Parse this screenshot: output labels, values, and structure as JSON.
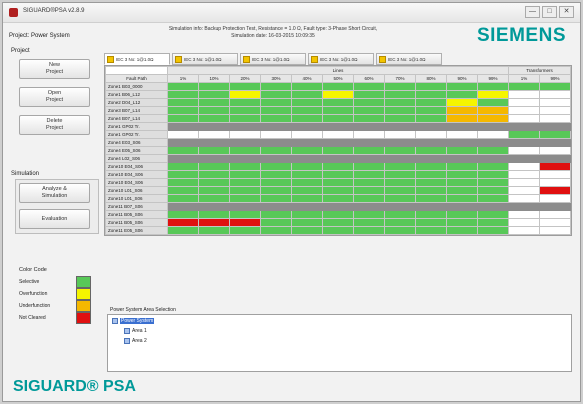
{
  "window": {
    "title": "SIGUARD®PSA v2.8.9",
    "buttons": [
      "—",
      "□",
      "✕"
    ]
  },
  "project_label": "Project: Power System",
  "simulation_info": {
    "line1": "Simulation info: Backup Protection Test, Resistance = 1.0 Ω, Fault type: 3-Phase Short Circuit,",
    "line2": "Simulation date: 16-03-2015 10:09:35"
  },
  "brand_logo": "SIEMENS",
  "sidebar": {
    "project_title": "Project",
    "project_buttons": [
      "New\nProject",
      "Open\nProject",
      "Delete\nProject"
    ],
    "simulation_title": "Simulation",
    "simulation_buttons": [
      "Analyze &\nSimulation",
      "Evaluation"
    ]
  },
  "legend": {
    "title": "Color Code",
    "items": [
      {
        "label": "Selective",
        "color": "#58c858"
      },
      {
        "label": "Overfunction",
        "color": "#f5f500"
      },
      {
        "label": "Underfunction",
        "color": "#f5b800"
      },
      {
        "label": "Not Cleared",
        "color": "#e01010"
      }
    ]
  },
  "tabs": [
    {
      "label": "IEC 3 No: 1@1.0Ω",
      "active": true
    },
    {
      "label": "IEC 3 No: 1@1.0Ω",
      "active": false
    },
    {
      "label": "IEC 3 No: 1@1.0Ω",
      "active": false
    },
    {
      "label": "IEC 3 No: 1@1.0Ω",
      "active": false
    },
    {
      "label": "IEC 3 No: 1@1.0Ω",
      "active": false
    }
  ],
  "grid": {
    "group_lines": "Lines",
    "group_transformers": "Transformers",
    "fault_path_header": "Fault Path",
    "line_columns": [
      "1%",
      "10%",
      "20%",
      "30%",
      "40%",
      "50%",
      "60%",
      "70%",
      "80%",
      "90%",
      "99%"
    ],
    "transformer_columns": [
      "1%",
      "99%"
    ],
    "rows": [
      {
        "label": "Zone1 B03_0000",
        "sep": false,
        "cells": "GGGGGGGGGGGGG"
      },
      {
        "label": "Zone1 B06_L12",
        "sep": false,
        "cells": "GGYGGYGGGGYWW"
      },
      {
        "label": "Zone2 D04_L12",
        "sep": false,
        "cells": "GGGGGGGGGYGWW"
      },
      {
        "label": "Zone3 B07_L14",
        "sep": false,
        "cells": "GGGGGGGGGOOWW"
      },
      {
        "label": "Zone4 B07_L14",
        "sep": false,
        "cells": "GGGGGGGGGOOWW"
      },
      {
        "label": "Zone1 GP02 Tr.",
        "sep": true,
        "cells": "WWWWWWWWWWWGG"
      },
      {
        "label": "Zone1 GP02 Tr.",
        "sep": false,
        "cells": "WWWWWWWWWWWGG"
      },
      {
        "label": "Zone4 E03_S06",
        "sep": true,
        "cells": "GGGGGGGGGGGWW"
      },
      {
        "label": "Zone4 E05_S06",
        "sep": false,
        "cells": "GGGGGGGGGGGWW"
      },
      {
        "label": "Zone4 L02_S06",
        "sep": true,
        "cells": "GGGGGGGGGGGWW"
      },
      {
        "label": "Zone10 E04_S06",
        "sep": false,
        "cells": "GGGGGGGGGGGWR"
      },
      {
        "label": "Zone10 E04_S06",
        "sep": false,
        "cells": "GGGGGGGGGGGWW"
      },
      {
        "label": "Zone10 E04_S06",
        "sep": false,
        "cells": "GGGGGGGGGGGWW"
      },
      {
        "label": "Zone10 L01_S06",
        "sep": false,
        "cells": "GGGGGGGGGGGWR"
      },
      {
        "label": "Zone10 L01_S06",
        "sep": false,
        "cells": "GGGGGGGGGGGWW"
      },
      {
        "label": "Zone11 B07_S06",
        "sep": true,
        "cells": "OOOOOOOOOOOWW"
      },
      {
        "label": "Zone11 B05_S06",
        "sep": false,
        "cells": "GGGGGGGGGGGWW"
      },
      {
        "label": "Zone11 B05_S06",
        "sep": false,
        "cells": "RRRGGGGGGGGWW"
      },
      {
        "label": "Zone11 E05_S06",
        "sep": false,
        "cells": "GGGGGGGGGGGWW"
      }
    ]
  },
  "area_selection": {
    "title": "Power System Area Selection",
    "tree": [
      "Power System",
      "Area 1",
      "Area 2"
    ]
  },
  "product_name": "SIGUARD® PSA"
}
